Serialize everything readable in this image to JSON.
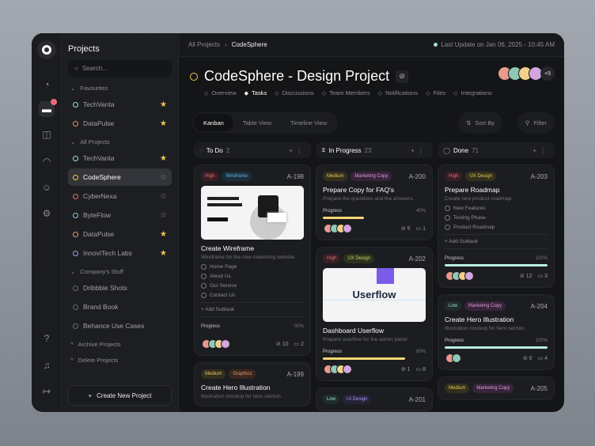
{
  "sidebar": {
    "title": "Projects",
    "search_placeholder": "Search...",
    "sections": [
      {
        "label": "Favourites",
        "items": [
          {
            "label": "TechVanta",
            "color": "#9ee3c9",
            "starred": true
          },
          {
            "label": "DataPulse",
            "color": "#e59a6c",
            "starred": true
          }
        ]
      },
      {
        "label": "All Projects",
        "items": [
          {
            "label": "TechVanta",
            "color": "#9ee3c9",
            "starred": true
          },
          {
            "label": "CodeSphere",
            "color": "#f4c44e",
            "starred": false,
            "active": true
          },
          {
            "label": "CyberNexa",
            "color": "#e8697a",
            "starred": false
          },
          {
            "label": "ByteFlow",
            "color": "#8fc3e6",
            "starred": false
          },
          {
            "label": "DataPulse",
            "color": "#e59a6c",
            "starred": true
          },
          {
            "label": "InnovITech Labs",
            "color": "#a89cf0",
            "starred": true
          }
        ]
      },
      {
        "label": "Company's Stuff",
        "items": [
          {
            "label": "Dribbble Shots",
            "color": "#6a6b70"
          },
          {
            "label": "Brand Book",
            "color": "#6a6b70"
          },
          {
            "label": "Behance Use Cases",
            "color": "#6a6b70"
          }
        ]
      }
    ],
    "archive": "Archive Projects",
    "deleted": "Delete Projects",
    "create": "Create New Project"
  },
  "header": {
    "breadcrumb_root": "All Projects",
    "breadcrumb_current": "CodeSphere",
    "last_update": "Last Update on Jan 06, 2025 - 10:45 AM"
  },
  "project": {
    "title": "CodeSphere - Design Project",
    "extra_members": "+5",
    "tabs": [
      "Overview",
      "Tasks",
      "Discussions",
      "Team Members",
      "Notifications",
      "Files",
      "Integrations"
    ],
    "active_tab": 1
  },
  "views": [
    "Kanban",
    "Table View",
    "Timeline View"
  ],
  "sort": "Sort By",
  "filter": "Filter",
  "columns": [
    {
      "name": "To Do",
      "count": "2",
      "icon": "◌",
      "cards": [
        {
          "tags": [
            [
              "High",
              "#3a1f24",
              "#e8697a"
            ],
            [
              "Wireframe",
              "#1c2e3a",
              "#5fb4e8"
            ]
          ],
          "id": "A-198",
          "image": "wireframe",
          "title": "Create Wireframe",
          "desc": "Wireframe for the new marketing website.",
          "subtasks": [
            "Home Page",
            "About Us",
            "Our Service",
            "Contact Us"
          ],
          "add": "Add Subtask",
          "progress_label": "Progress",
          "progress": "00%",
          "pct": 0,
          "color": "#f7d774",
          "avatars": 4,
          "links": "10",
          "comments": "2"
        },
        {
          "tags": [
            [
              "Medium",
              "#34301d",
              "#e8c95a"
            ],
            [
              "Graphics",
              "#3a2820",
              "#e59a6c"
            ]
          ],
          "id": "A-199",
          "title": "Create Hero Illustration",
          "desc": "Illustration mockup for hero section."
        }
      ]
    },
    {
      "name": "In Progress",
      "count": "23",
      "icon": "⧗",
      "cards": [
        {
          "tags": [
            [
              "Medium",
              "#34301d",
              "#e8c95a"
            ],
            [
              "Marketing Copy",
              "#36243a",
              "#e09bd5"
            ]
          ],
          "id": "A-200",
          "title": "Prepare Copy for FAQ's",
          "desc": "Prepare the questions and the answers.",
          "progress_label": "Progress",
          "progress": "40%",
          "pct": 40,
          "color": "#f7d774",
          "avatars": 4,
          "links": "5",
          "comments": "1"
        },
        {
          "tags": [
            [
              "High",
              "#3a1f24",
              "#e8697a"
            ],
            [
              "UX Design",
              "#2c321d",
              "#c7d77a"
            ]
          ],
          "id": "A-202",
          "image": "userflow",
          "image_text": "Userflow",
          "title": "Dashboard Userflow",
          "desc": "Prepare userflow for the admin panel.",
          "progress_label": "Progress",
          "progress": "80%",
          "pct": 80,
          "color": "#f7d774",
          "avatars": 4,
          "links": "1",
          "comments": "8"
        },
        {
          "tags": [
            [
              "Low",
              "#1f2e2a",
              "#9ee3c9"
            ],
            [
              "UI Design",
              "#25233a",
              "#a89cf0"
            ]
          ],
          "id": "A-201",
          "title": "",
          "desc": ""
        }
      ]
    },
    {
      "name": "Done",
      "count": "71",
      "icon": "◯",
      "cards": [
        {
          "tags": [
            [
              "High",
              "#3a1f24",
              "#e8697a"
            ],
            [
              "UX Design",
              "#34301d",
              "#e8c95a"
            ]
          ],
          "id": "A-203",
          "title": "Prepare Roadmap",
          "desc": "Create new product roadmap.",
          "subtasks": [
            "New Features",
            "Testing Phase",
            "Product Roadmap"
          ],
          "add": "Add Subtask",
          "progress_label": "Progress",
          "progress": "100%",
          "pct": 100,
          "color": "#b8f0dc",
          "avatars": 4,
          "links": "12",
          "comments": "3"
        },
        {
          "tags": [
            [
              "Low",
              "#1f2e2a",
              "#9ee3c9"
            ],
            [
              "Marketing Copy",
              "#36243a",
              "#e09bd5"
            ]
          ],
          "id": "A-204",
          "title": "Create Hero Illustration",
          "desc": "Illustration mockup for hero section.",
          "progress_label": "Progress",
          "progress": "100%",
          "pct": 100,
          "color": "#b8f0dc",
          "avatars": 2,
          "links": "0",
          "comments": "4"
        },
        {
          "tags": [
            [
              "Medium",
              "#34301d",
              "#e8c95a"
            ],
            [
              "Marketing Copy",
              "#36243a",
              "#e09bd5"
            ]
          ],
          "id": "A-205",
          "title": "",
          "desc": ""
        }
      ]
    }
  ]
}
